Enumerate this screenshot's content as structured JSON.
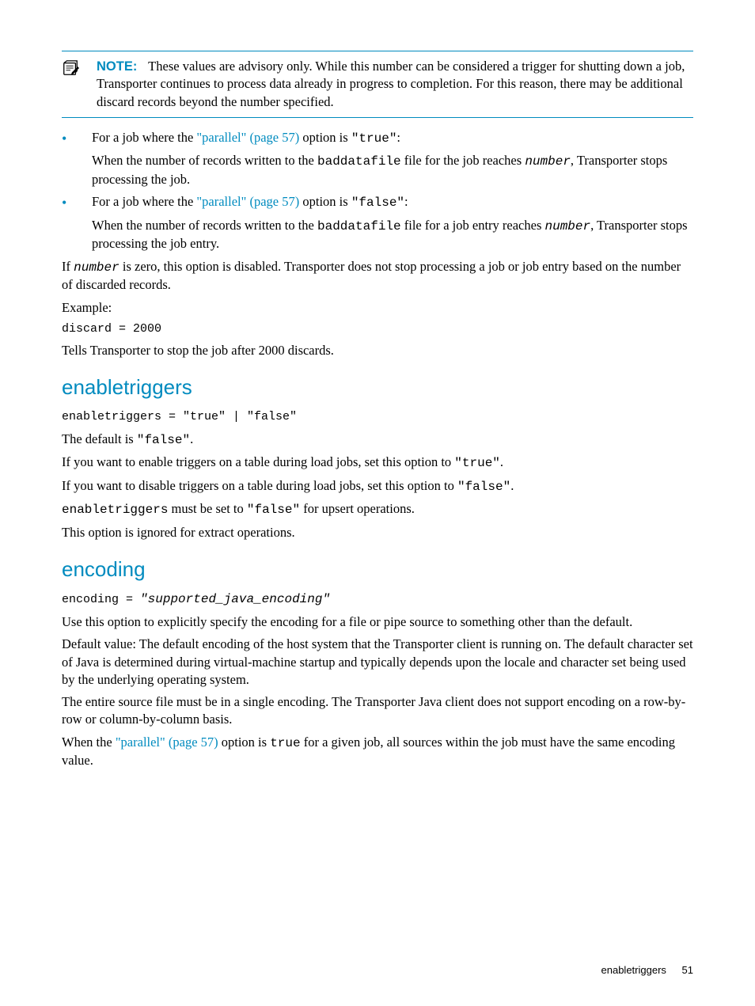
{
  "note": {
    "label": "NOTE:",
    "text": "These values are advisory only. While this number can be considered a trigger for shutting down a job, Transporter continues to process data already in progress to completion. For this reason, there may be additional discard records beyond the number specified."
  },
  "bullets": {
    "b1": {
      "pre": "For a job where the ",
      "link": "\"parallel\" (page 57)",
      "post": " option is ",
      "code1": "\"true\"",
      "tail": ":",
      "line2a": "When the number of records written to the ",
      "line2b": "baddatafile",
      "line2c": " file for the job reaches ",
      "line2d": "number",
      "line2e": ", Transporter stops processing the job."
    },
    "b2": {
      "pre": "For a job where the ",
      "link": "\"parallel\" (page 57)",
      "post": " option is ",
      "code1": "\"false\"",
      "tail": ":",
      "line2a": "When the number of records written to the ",
      "line2b": "baddatafile",
      "line2c": " file for a job entry reaches ",
      "line2d": "number",
      "line2e": ", Transporter stops processing the job entry."
    }
  },
  "afterBullets": {
    "p1a": "If ",
    "p1b": "number",
    "p1c": " is zero, this option is disabled. Transporter does not stop processing a job or job entry based on the number of discarded records.",
    "p2": "Example:",
    "code": "discard = 2000",
    "p3": "Tells Transporter to stop the job after 2000 discards."
  },
  "enabletriggers": {
    "heading": "enabletriggers",
    "syntax": "enabletriggers = \"true\" | \"false\"",
    "p1a": "The default is ",
    "p1b": "\"false\"",
    "p1c": ".",
    "p2a": "If you want to enable triggers on a table during load jobs, set this option to ",
    "p2b": "\"true\"",
    "p2c": ".",
    "p3a": "If you want to disable triggers on a table during load jobs, set this option to ",
    "p3b": "\"false\"",
    "p3c": ".",
    "p4a": "enabletriggers",
    "p4b": " must be set to ",
    "p4c": "\"false\"",
    "p4d": " for upsert operations.",
    "p5": "This option is ignored for extract operations."
  },
  "encoding": {
    "heading": "encoding",
    "syntax_a": "encoding = ",
    "syntax_b": "\"supported_java_encoding\"",
    "p1": "Use this option to explicitly specify the encoding for a file or pipe source to something other than the default.",
    "p2": "Default value: The default encoding of the host system that the Transporter client is running on. The default character set of Java is determined during virtual-machine startup and typically depends upon the locale and character set being used by the underlying operating system.",
    "p3": "The entire source file must be in a single encoding. The Transporter Java client does not support encoding on a row-by-row or column-by-column basis.",
    "p4a": "When the ",
    "p4link": "\"parallel\" (page 57)",
    "p4b": " option is ",
    "p4c": "true",
    "p4d": " for a given job, all sources within the job must have the same encoding value."
  },
  "footer": {
    "section": "enabletriggers",
    "page": "51"
  }
}
